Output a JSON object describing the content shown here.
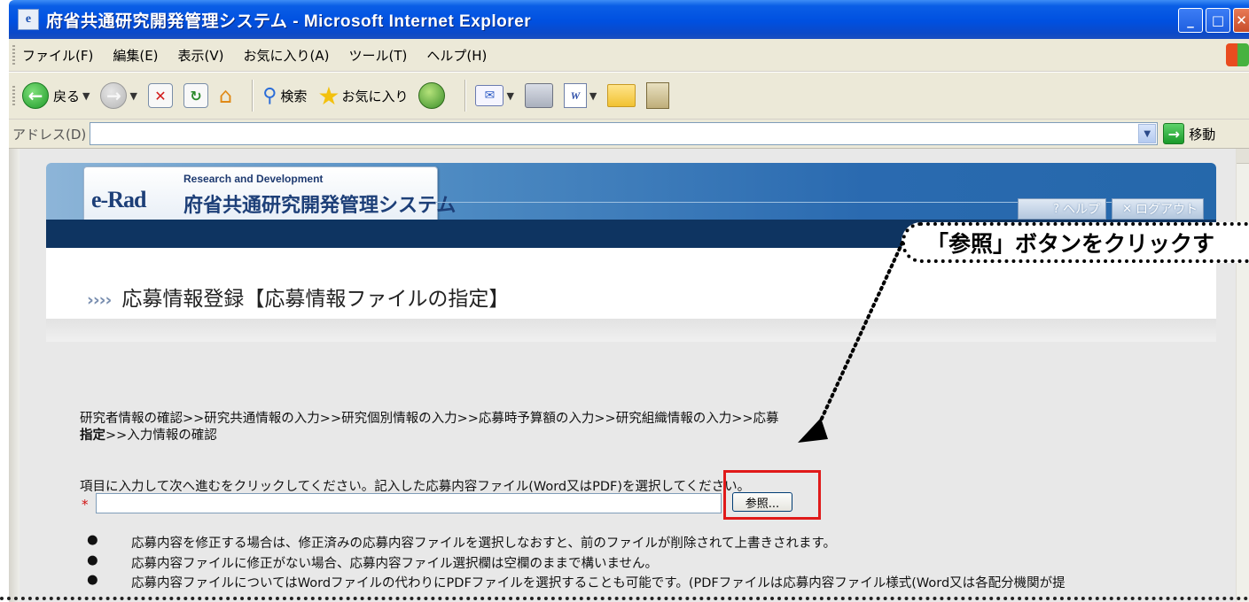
{
  "window": {
    "title": "府省共通研究開発管理システム - Microsoft Internet Explorer"
  },
  "menu": [
    "ファイル(F)",
    "編集(E)",
    "表示(V)",
    "お気に入り(A)",
    "ツール(T)",
    "ヘルプ(H)"
  ],
  "toolbar": {
    "back_label": "戻る",
    "search_label": "検索",
    "favorites_label": "お気に入り"
  },
  "address": {
    "label": "アドレス(D)",
    "value": "",
    "go_label": "移動"
  },
  "header": {
    "logo_en": "Research and Development",
    "logo_mark": "e-Rad",
    "logo_ja": "府省共通研究開発管理システム",
    "help_label": "ヘルプ",
    "logout_label": "ログアウト"
  },
  "page": {
    "title": "応募情報登録【応募情報ファイルの指定】",
    "breadcrumb_line1": "研究者情報の確認>>研究共通情報の入力>>研究個別情報の入力>>応募時予算額の入力>>研究組織情報の入力>>応募",
    "breadcrumb_bold": "指定",
    "breadcrumb_line2": ">>入力情報の確認",
    "instruction": "項目に入力して次へ進むをクリックしてください。記入した応募内容ファイル(Word又はPDF)を選択してください。",
    "required_mark": "*",
    "file_value": "",
    "browse_label": "参照...",
    "notes": [
      "応募内容を修正する場合は、修正済みの応募内容ファイルを選択しなおすと、前のファイルが削除されて上書きされます。",
      "応募内容ファイルに修正がない場合、応募内容ファイル選択欄は空欄のままで構いません。",
      "応募内容ファイルについてはWordファイルの代わりにPDFファイルを選択することも可能です。(PDFファイルは応募内容ファイル様式(Word又は各配分機関が提"
    ]
  },
  "callout": {
    "text": "「参照」ボタンをクリックす"
  }
}
